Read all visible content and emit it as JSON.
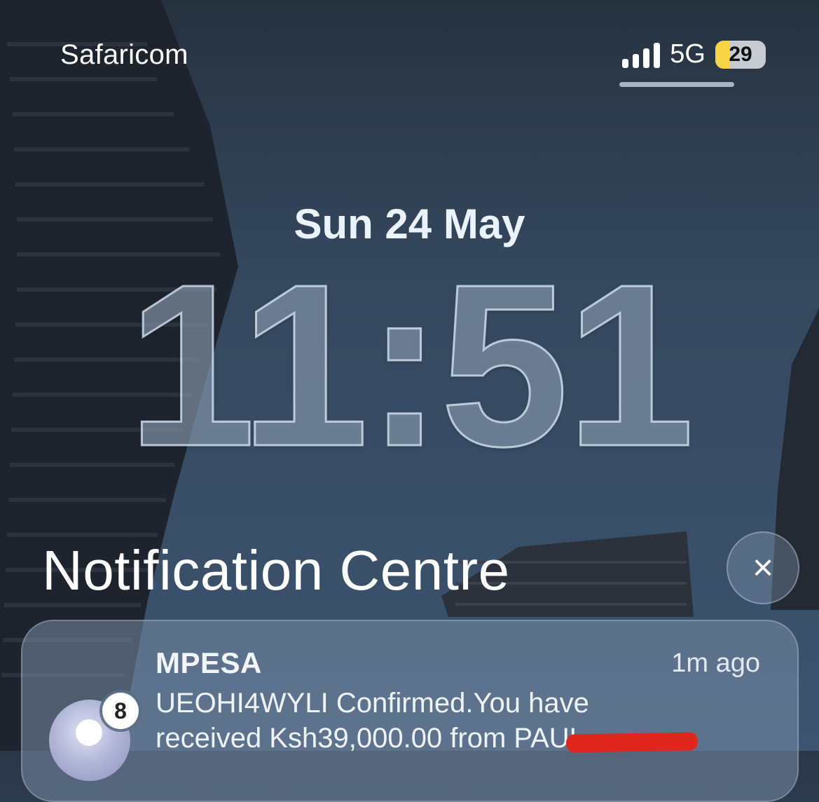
{
  "status_bar": {
    "carrier": "Safaricom",
    "network": "5G",
    "battery_level": "29",
    "signal_bars": 4
  },
  "lock_screen": {
    "date": "Sun 24 May",
    "time": "11:51"
  },
  "notification_centre": {
    "title": "Notification Centre",
    "close_icon": "×"
  },
  "notification": {
    "app": "MPESA",
    "time_ago": "1m ago",
    "body_line1": "UEOHI4WYLI Confirmed.You have",
    "body_line2": "received Ksh39,000.00 from PAUL",
    "badge_count": "8"
  },
  "colors": {
    "battery_fill": "#f6d443",
    "redaction": "#e0271e"
  }
}
